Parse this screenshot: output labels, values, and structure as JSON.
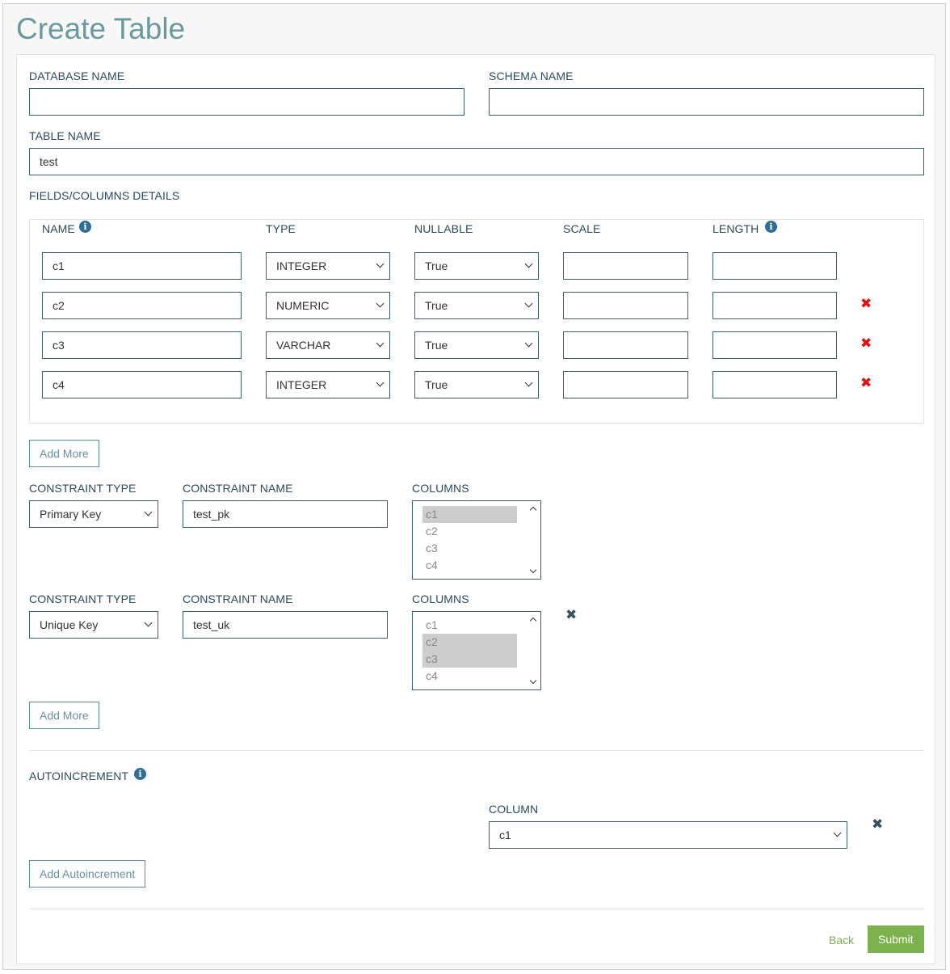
{
  "page": {
    "title": "Create Table"
  },
  "database": {
    "label": "DATABASE NAME",
    "value": ""
  },
  "schema": {
    "label": "SCHEMA NAME",
    "value": ""
  },
  "table": {
    "label": "TABLE NAME",
    "value": "test"
  },
  "fields": {
    "section_label": "FIELDS/COLUMNS DETAILS",
    "headers": {
      "name": "NAME",
      "type": "TYPE",
      "nullable": "NULLABLE",
      "scale": "SCALE",
      "length": "LENGTH"
    },
    "rows": [
      {
        "name": "c1",
        "type": "INTEGER",
        "nullable": "True",
        "scale": "",
        "length": "",
        "removable": false
      },
      {
        "name": "c2",
        "type": "NUMERIC",
        "nullable": "True",
        "scale": "",
        "length": "",
        "removable": true
      },
      {
        "name": "c3",
        "type": "VARCHAR",
        "nullable": "True",
        "scale": "",
        "length": "",
        "removable": true
      },
      {
        "name": "c4",
        "type": "INTEGER",
        "nullable": "True",
        "scale": "",
        "length": "",
        "removable": true
      }
    ],
    "add_more_label": "Add More"
  },
  "constraints": {
    "type_label": "CONSTRAINT TYPE",
    "name_label": "CONSTRAINT NAME",
    "columns_label": "COLUMNS",
    "items": [
      {
        "type": "Primary Key",
        "name": "test_pk",
        "columns": [
          "c1",
          "c2",
          "c3",
          "c4"
        ],
        "selected": [
          "c1"
        ]
      },
      {
        "type": "Unique Key",
        "name": "test_uk",
        "columns": [
          "c1",
          "c2",
          "c3",
          "c4"
        ],
        "selected": [
          "c2",
          "c3"
        ]
      }
    ],
    "add_more_label": "Add More"
  },
  "autoincrement": {
    "label": "AUTOINCREMENT",
    "column_label": "COLUMN",
    "column_value": "c1",
    "add_label": "Add Autoincrement"
  },
  "footer": {
    "back_label": "Back",
    "submit_label": "Submit"
  },
  "icons": {
    "info": "info-icon",
    "remove_row": "remove-icon",
    "remove_dark": "close-icon"
  },
  "colors": {
    "title": "#6a9aa0",
    "submit": "#7cb24e",
    "remove": "#e01010",
    "info": "#2f6e95"
  }
}
